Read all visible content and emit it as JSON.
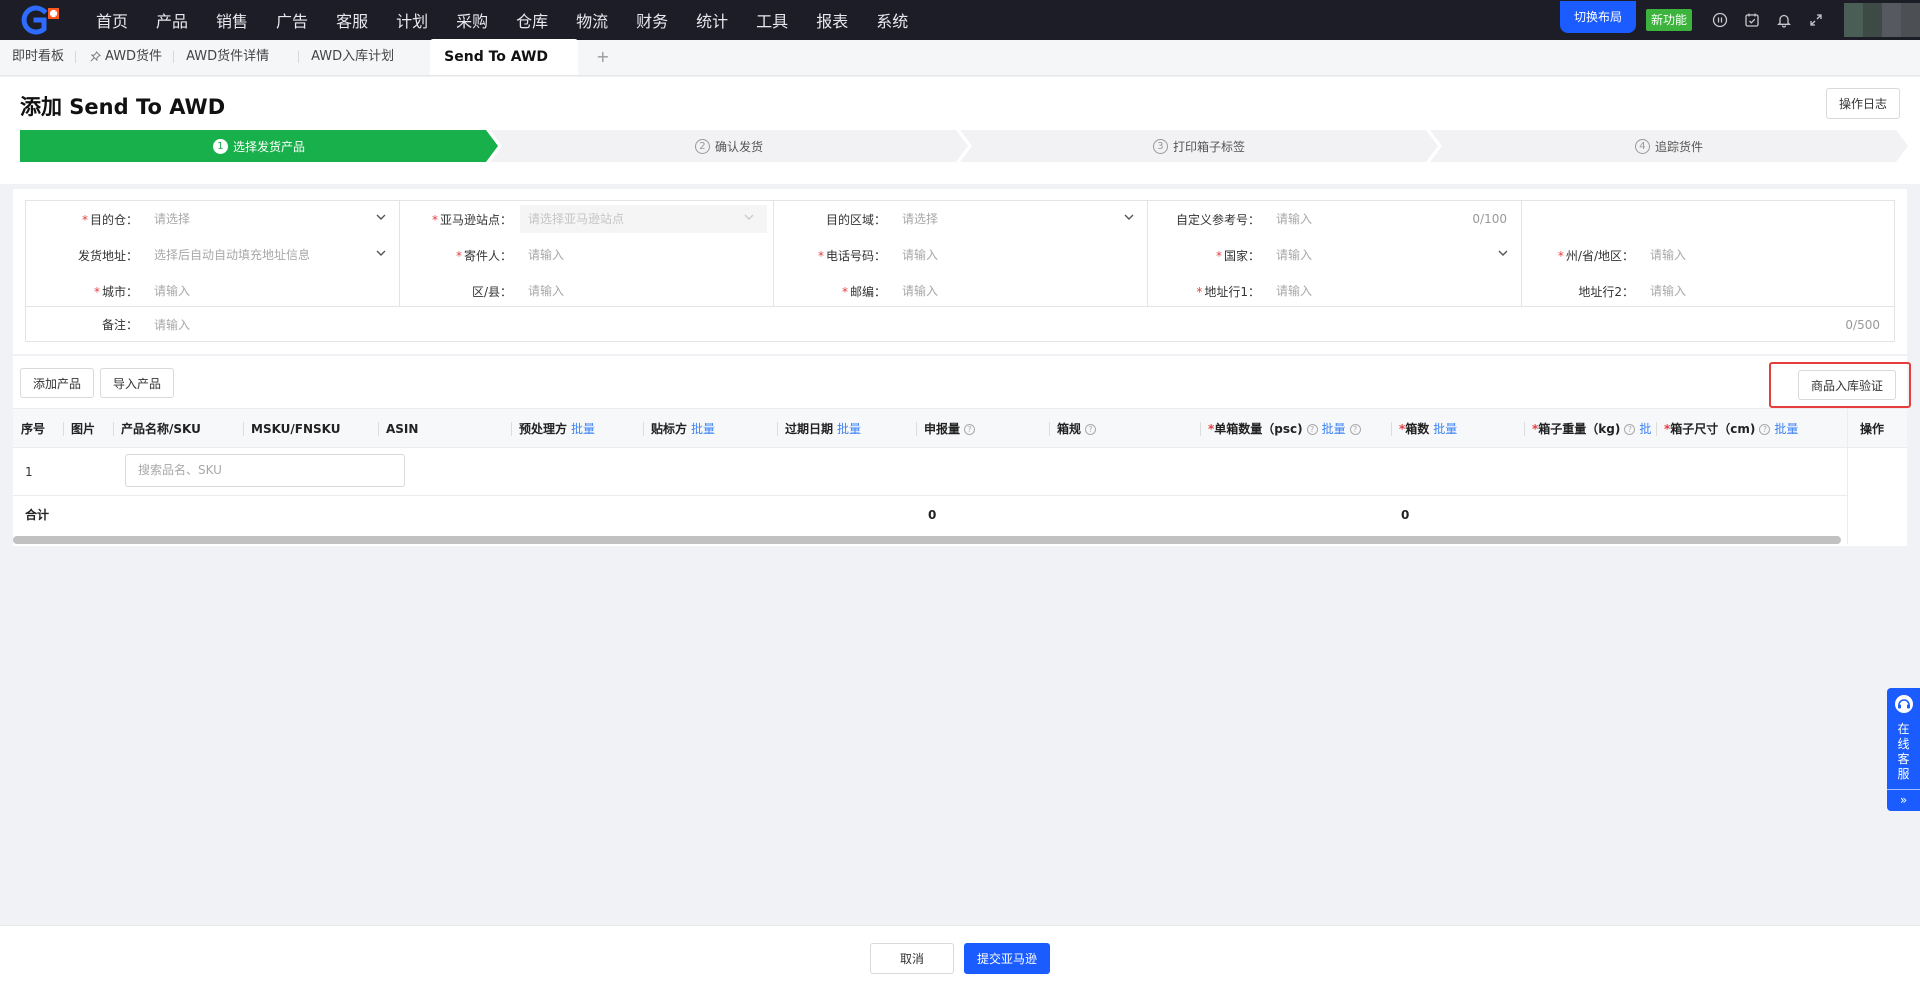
{
  "nav": {
    "items": [
      "首页",
      "产品",
      "销售",
      "广告",
      "客服",
      "计划",
      "采购",
      "仓库",
      "物流",
      "财务",
      "统计",
      "工具",
      "报表",
      "系统"
    ],
    "switch_layout": "切换布局",
    "new_feature": "新功能"
  },
  "tabs": {
    "items": [
      "即时看板",
      "AWD货件",
      "AWD货件详情",
      "AWD入库计划",
      "Send To AWD"
    ],
    "plus": "+"
  },
  "header": {
    "title": "添加 Send To AWD",
    "log_button": "操作日志"
  },
  "steps": [
    {
      "num": "1",
      "label": "选择发货产品"
    },
    {
      "num": "2",
      "label": "确认发货"
    },
    {
      "num": "3",
      "label": "打印箱子标签"
    },
    {
      "num": "4",
      "label": "追踪货件"
    }
  ],
  "form": {
    "dest_warehouse": {
      "label": "目的仓：",
      "placeholder": "请选择"
    },
    "ship_address": {
      "label": "发货地址：",
      "placeholder": "选择后自动自动填充地址信息"
    },
    "city": {
      "label": "城市：",
      "placeholder": "请输入"
    },
    "amazon_site": {
      "label": "亚马逊站点：",
      "placeholder": "请选择亚马逊站点"
    },
    "sender": {
      "label": "寄件人：",
      "placeholder": "请输入"
    },
    "district": {
      "label": "区/县：",
      "placeholder": "请输入"
    },
    "dest_region": {
      "label": "目的区域：",
      "placeholder": "请选择"
    },
    "phone": {
      "label": "电话号码：",
      "placeholder": "请输入"
    },
    "postcode": {
      "label": "邮编：",
      "placeholder": "请输入"
    },
    "custom_ref": {
      "label": "自定义参考号：",
      "placeholder": "请输入",
      "counter": "0/100"
    },
    "country": {
      "label": "国家：",
      "placeholder": "请输入"
    },
    "address1": {
      "label": "地址行1：",
      "placeholder": "请输入"
    },
    "state": {
      "label": "州/省/地区：",
      "placeholder": "请输入"
    },
    "address2": {
      "label": "地址行2：",
      "placeholder": "请输入"
    },
    "notes": {
      "label": "备注：",
      "placeholder": "请输入",
      "counter": "0/500"
    }
  },
  "products": {
    "add_button": "添加产品",
    "import_button": "导入产品",
    "verify_button": "商品入库验证",
    "batch_label": "批量",
    "batch_short": "批",
    "columns": {
      "index": "序号",
      "image": "图片",
      "name_sku": "产品名称/SKU",
      "msku": "MSKU/FNSKU",
      "asin": "ASIN",
      "prep": "预处理方",
      "label_party": "贴标方",
      "expiry": "过期日期",
      "declared": "申报量",
      "box_spec": "箱规",
      "units_per_box": "单箱数量（psc)",
      "box_count": "箱数",
      "box_weight": "箱子重量（kg)",
      "box_size": "箱子尺寸（cm)",
      "actions": "操作"
    },
    "rows": [
      {
        "index": "1",
        "search_placeholder": "搜索品名、SKU"
      }
    ],
    "total": {
      "label": "合计",
      "declared": "0",
      "box_count": "0"
    }
  },
  "footer": {
    "cancel": "取消",
    "submit": "提交亚马逊"
  },
  "service": {
    "label": "在线客服",
    "arrow": "»"
  }
}
